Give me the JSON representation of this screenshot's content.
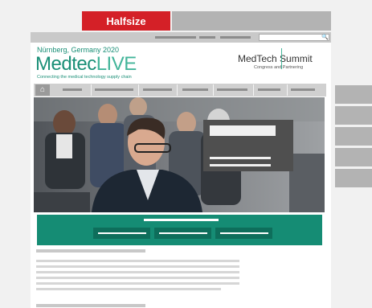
{
  "tabs": {
    "halfsize_label": "Halfsize"
  },
  "header": {
    "location": "Nürnberg, Germany 2020",
    "logo_main": "Medtec",
    "logo_accent": "LIVE",
    "tagline": "Connecting the medical technology supply chain",
    "partner_logo": "MedTech Summit",
    "partner_sub": "Congress and Partnering"
  },
  "icons": {
    "home": "home-icon",
    "search": "search-icon"
  },
  "colors": {
    "brand_teal": "#158c74",
    "accent_red": "#d42027",
    "logo_green": "#43b59a"
  }
}
